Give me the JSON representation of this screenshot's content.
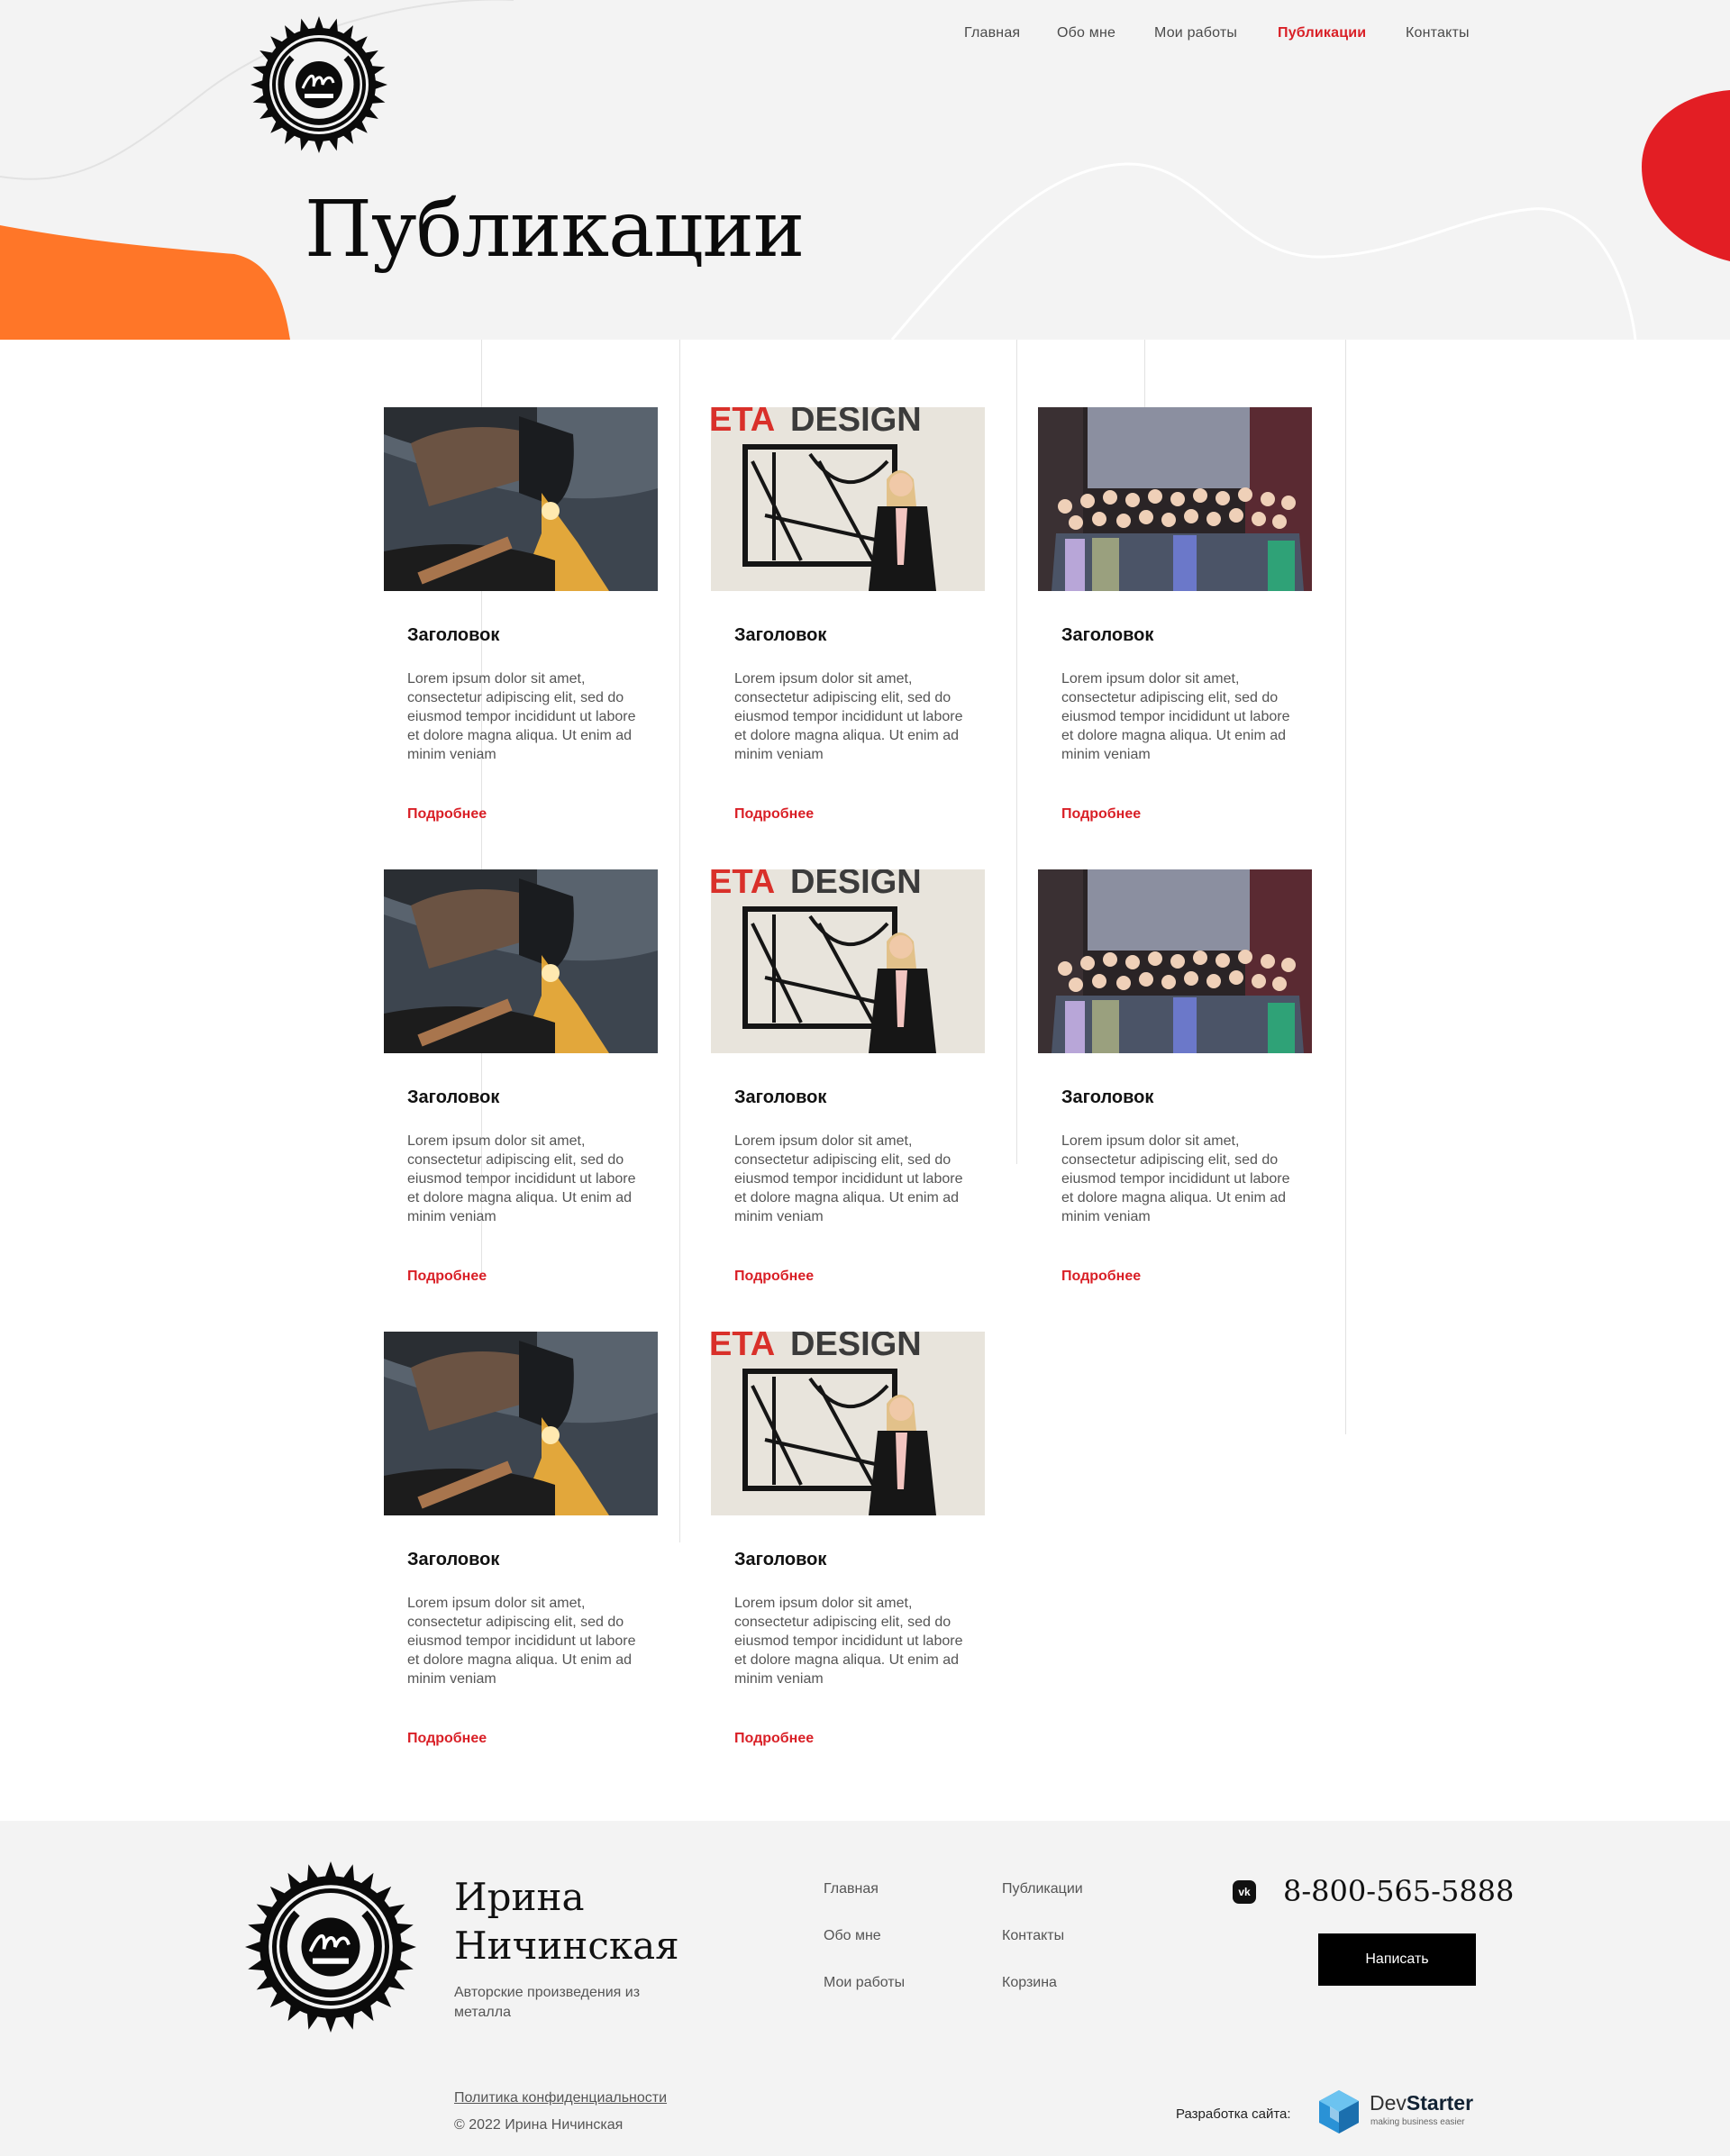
{
  "nav": {
    "items": [
      {
        "label": "Главная",
        "active": false
      },
      {
        "label": "Обо мне",
        "active": false
      },
      {
        "label": "Мои работы",
        "active": false
      },
      {
        "label": "Публикации",
        "active": true
      },
      {
        "label": "Контакты",
        "active": false
      }
    ]
  },
  "page": {
    "title": "Публикации"
  },
  "colors": {
    "accent": "#d91f26",
    "orange": "#ff7628",
    "red_blob": "#e31e24",
    "bg": "#f3f3f3"
  },
  "cards": [
    {
      "image": "plasma-cutting",
      "title": "Заголовок",
      "text": "Lorem ipsum dolor sit amet, consectetur adipiscing elit, sed do eiusmod tempor incididunt ut labore et dolore magna aliqua. Ut enim ad minim veniam",
      "more": "Подробнее"
    },
    {
      "image": "metadesign-portrait",
      "title": "Заголовок",
      "text": "Lorem ipsum dolor sit amet, consectetur adipiscing elit, sed do eiusmod tempor incididunt ut labore et dolore magna aliqua. Ut enim ad minim veniam",
      "more": "Подробнее"
    },
    {
      "image": "group-photo",
      "title": "Заголовок",
      "text": "Lorem ipsum dolor sit amet, consectetur adipiscing elit, sed do eiusmod tempor incididunt ut labore et dolore magna aliqua. Ut enim ad minim veniam",
      "more": "Подробнее"
    },
    {
      "image": "plasma-cutting",
      "title": "Заголовок",
      "text": "Lorem ipsum dolor sit amet, consectetur adipiscing elit, sed do eiusmod tempor incididunt ut labore et dolore magna aliqua. Ut enim ad minim veniam",
      "more": "Подробнее"
    },
    {
      "image": "metadesign-portrait",
      "title": "Заголовок",
      "text": "Lorem ipsum dolor sit amet, consectetur adipiscing elit, sed do eiusmod tempor incididunt ut labore et dolore magna aliqua. Ut enim ad minim veniam",
      "more": "Подробнее"
    },
    {
      "image": "group-photo",
      "title": "Заголовок",
      "text": "Lorem ipsum dolor sit amet, consectetur adipiscing elit, sed do eiusmod tempor incididunt ut labore et dolore magna aliqua. Ut enim ad minim veniam",
      "more": "Подробнее"
    },
    {
      "image": "plasma-cutting",
      "title": "Заголовок",
      "text": "Lorem ipsum dolor sit amet, consectetur adipiscing elit, sed do eiusmod tempor incididunt ut labore et dolore magna aliqua. Ut enim ad minim veniam",
      "more": "Подробнее"
    },
    {
      "image": "metadesign-portrait",
      "title": "Заголовок",
      "text": "Lorem ipsum dolor sit amet, consectetur adipiscing elit, sed do eiusmod tempor incididunt ut labore et dolore magna aliqua. Ut enim ad minim veniam",
      "more": "Подробнее"
    }
  ],
  "footer": {
    "name_line1": "Ирина",
    "name_line2": "Ничинская",
    "tagline": "Авторские произведения из металла",
    "nav": [
      "Главная",
      "Обо мне",
      "Мои работы",
      "Публикации",
      "Контакты",
      "Корзина"
    ],
    "social_icon": "vk-icon",
    "phone": "8-800-565-5888",
    "write_button": "Написать",
    "policy": "Политика конфиденциальности",
    "copyright": "© 2022 Ирина Ничинская",
    "developer_label": "Разработка сайта:",
    "developer_name_a": "Dev",
    "developer_name_b": "Starter",
    "developer_slogan": "making business easier"
  }
}
